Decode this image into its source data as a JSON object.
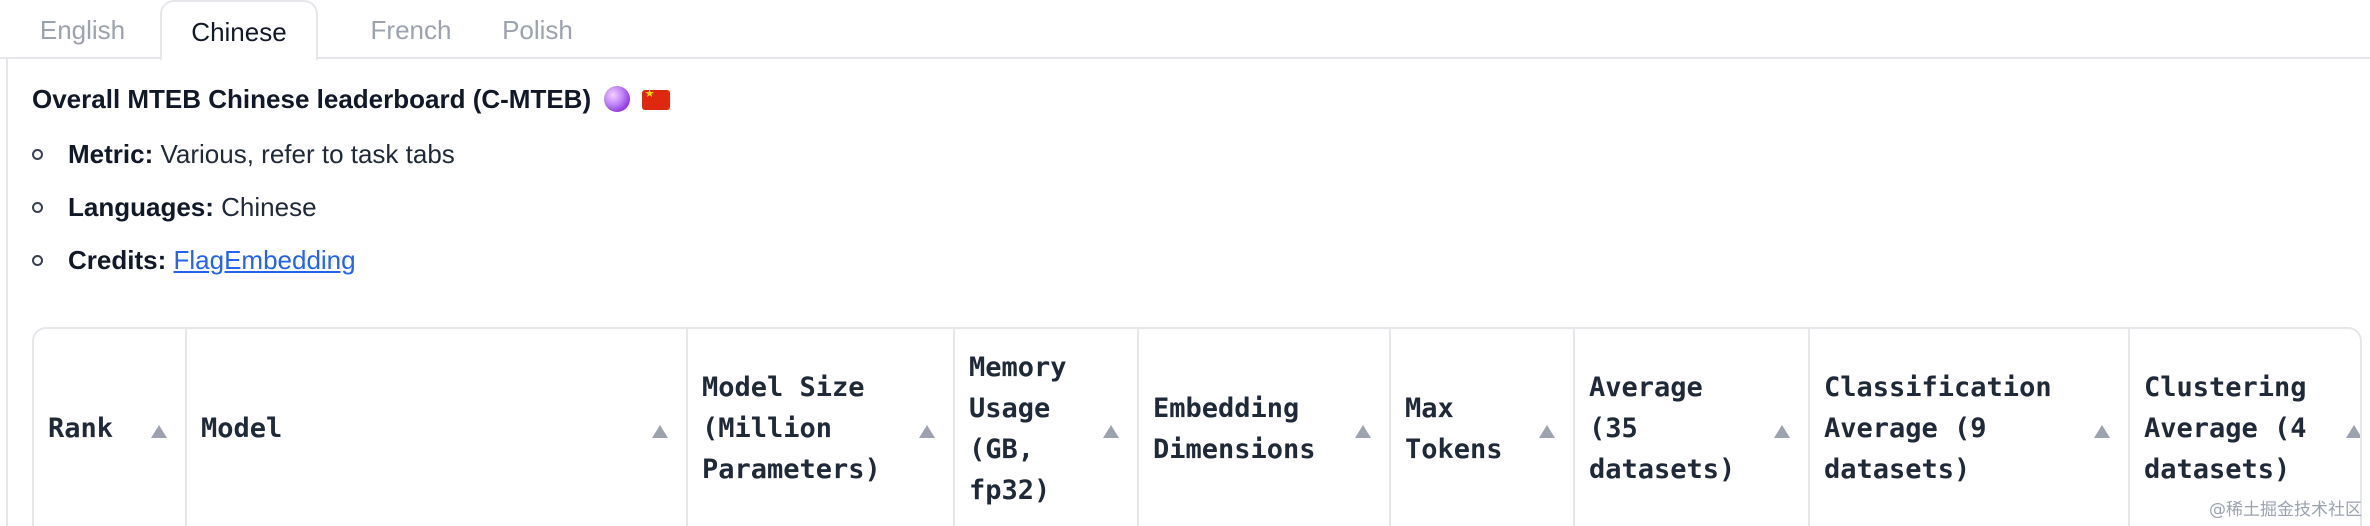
{
  "tabs": [
    {
      "label": "English",
      "active": false
    },
    {
      "label": "Chinese",
      "active": true
    },
    {
      "label": "French",
      "active": false
    },
    {
      "label": "Polish",
      "active": false
    }
  ],
  "heading": {
    "title": "Overall MTEB Chinese leaderboard (C-MTEB)",
    "icons": [
      "crystal-ball-icon",
      "china-flag-icon"
    ]
  },
  "info": {
    "metric_label": "Metric:",
    "metric_value": "Various, refer to task tabs",
    "languages_label": "Languages:",
    "languages_value": "Chinese",
    "credits_label": "Credits:",
    "credits_link": "FlagEmbedding"
  },
  "table": {
    "columns": [
      "Rank",
      "Model",
      "Model Size\n(Million\nParameters)",
      "Memory\nUsage\n(GB,\nfp32)",
      "Embedding\nDimensions",
      "Max\nTokens",
      "Average\n(35\ndatasets)",
      "Classification\nAverage (9\ndatasets)",
      "Clustering\nAverage (4\ndatasets)"
    ]
  },
  "watermark": "@稀土掘金技术社区",
  "colors": {
    "link": "#2563eb",
    "border": "#e5e7eb",
    "muted": "#9ca3af"
  }
}
